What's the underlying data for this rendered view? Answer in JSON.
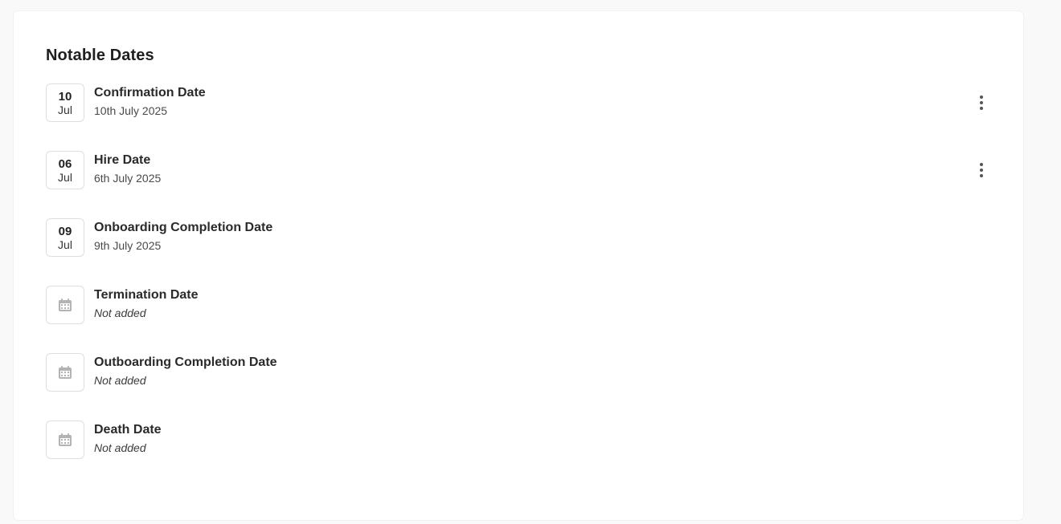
{
  "section": {
    "title": "Notable Dates"
  },
  "dates": [
    {
      "label": "Confirmation Date",
      "value": "10th July 2025",
      "day": "10",
      "month": "Jul",
      "has_menu": true,
      "menu_icon": "more-vertical-icon"
    },
    {
      "label": "Hire Date",
      "value": "6th July 2025",
      "day": "06",
      "month": "Jul",
      "has_menu": true,
      "menu_icon": "more-vertical-icon"
    },
    {
      "label": "Onboarding Completion Date",
      "value": "9th July 2025",
      "day": "09",
      "month": "Jul",
      "has_menu": false
    },
    {
      "label": "Termination Date",
      "value": "Not added",
      "empty_icon": "calendar-icon",
      "has_menu": false
    },
    {
      "label": "Outboarding Completion Date",
      "value": "Not added",
      "empty_icon": "calendar-icon",
      "has_menu": false
    },
    {
      "label": "Death Date",
      "value": "Not added",
      "empty_icon": "calendar-icon",
      "has_menu": false
    }
  ],
  "colors": {
    "card_bg": "#ffffff",
    "page_bg": "#f9f9f9",
    "border": "#dedede",
    "icon_muted": "#b3b3b3"
  }
}
